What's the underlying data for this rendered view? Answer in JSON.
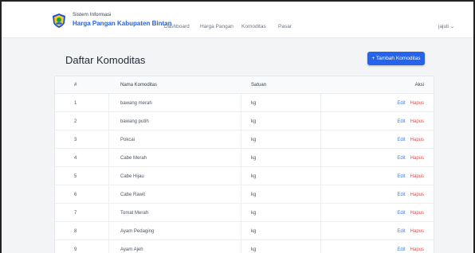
{
  "header": {
    "brand_small": "Sistem Informasi",
    "brand_big": "Harga Pangan Kabupaten Bintan",
    "nav": [
      "Dashboard",
      "Harga Pangan",
      "Komoditas",
      "Pasar"
    ],
    "user": "jajuli ⌄"
  },
  "page": {
    "title": "Daftar Komoditas",
    "add_button": "+ Tambah Komoditas"
  },
  "table": {
    "headers": [
      "#",
      "Nama Komoditas",
      "Satuan",
      "Aksi"
    ],
    "edit_label": "Edit",
    "delete_label": "Hapus",
    "rows": [
      {
        "num": "1",
        "name": "bawang merah",
        "unit": "kg"
      },
      {
        "num": "2",
        "name": "bawang putih",
        "unit": "kg"
      },
      {
        "num": "3",
        "name": "Pokcai",
        "unit": "kg"
      },
      {
        "num": "4",
        "name": "Cabe Merah",
        "unit": "kg"
      },
      {
        "num": "5",
        "name": "Cabe Hijau",
        "unit": "kg"
      },
      {
        "num": "6",
        "name": "Cabe Rawit",
        "unit": "kg"
      },
      {
        "num": "7",
        "name": "Tomat Merah",
        "unit": "kg"
      },
      {
        "num": "8",
        "name": "Ayam Pedaging",
        "unit": "kg"
      },
      {
        "num": "9",
        "name": "Ayam Ajeh",
        "unit": "kg"
      }
    ]
  },
  "colors": {
    "accent": "#2563eb",
    "edit": "#3b82f6",
    "delete": "#ef4444"
  }
}
